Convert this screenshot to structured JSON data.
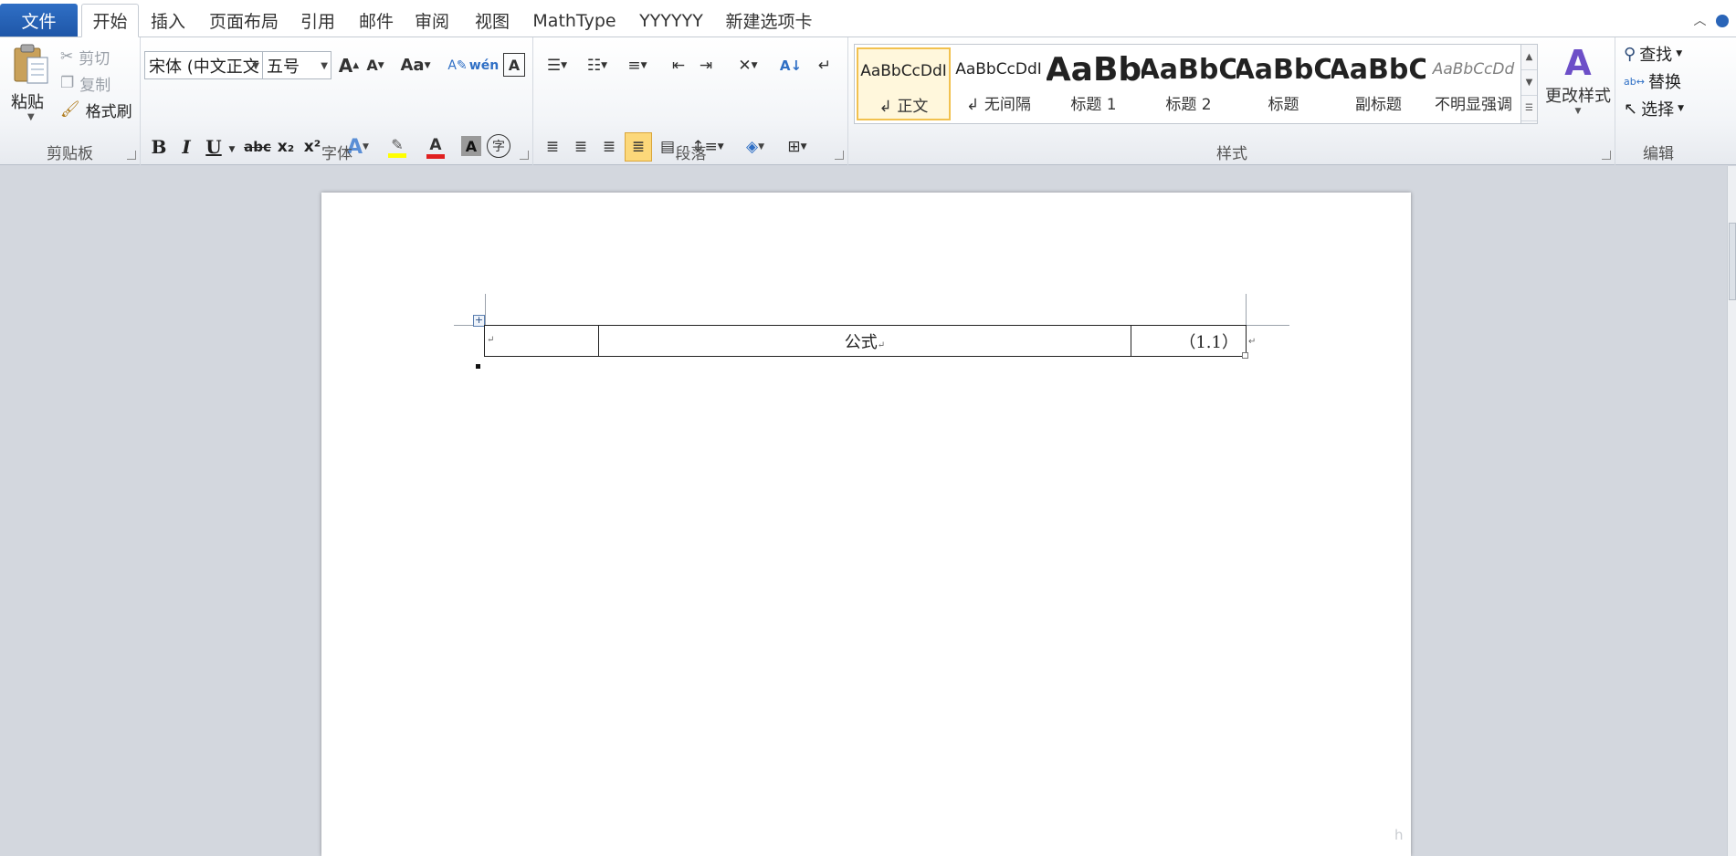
{
  "tabs": {
    "file": "文件",
    "items": [
      "开始",
      "插入",
      "页面布局",
      "引用",
      "邮件",
      "审阅",
      "视图",
      "MathType",
      "YYYYYY",
      "新建选项卡"
    ],
    "active_index": 0
  },
  "clipboard": {
    "paste": "粘贴",
    "cut": "剪切",
    "copy": "复制",
    "format_painter": "格式刷",
    "label": "剪贴板"
  },
  "font": {
    "name": "宋体 (中文正文",
    "size": "五号",
    "label": "字体",
    "grow": "A",
    "shrink": "A",
    "change_case": "Aa",
    "bold": "B",
    "italic": "I",
    "underline": "U",
    "strike": "abc",
    "subscript": "x₂",
    "superscript": "x²",
    "font_color_letter": "A",
    "shading_letter": "A",
    "enclose_char": "字"
  },
  "paragraph": {
    "label": "段落"
  },
  "styles": {
    "label": "样式",
    "items": [
      {
        "sample": "AaBbCcDdI",
        "name": "↲ 正文"
      },
      {
        "sample": "AaBbCcDdI",
        "name": "↲ 无间隔"
      },
      {
        "sample": "AaBb",
        "name": "标题 1"
      },
      {
        "sample": "AaBbC",
        "name": "标题 2"
      },
      {
        "sample": "AaBbC",
        "name": "标题"
      },
      {
        "sample": "AaBbC",
        "name": "副标题"
      },
      {
        "sample": "AaBbCcDd",
        "name": "不明显强调"
      }
    ],
    "change_styles": "更改样式"
  },
  "editing": {
    "label": "编辑",
    "find": "查找",
    "replace": "替换",
    "select": "选择"
  },
  "document": {
    "table": {
      "cells": [
        "",
        "公式",
        "（1.1）"
      ]
    },
    "watermark": "h"
  },
  "colors": {
    "file_tab": "#2a65b8",
    "highlight": "#ffff00",
    "font_color": "#e02020",
    "selected_style_border": "#f2c14e"
  }
}
